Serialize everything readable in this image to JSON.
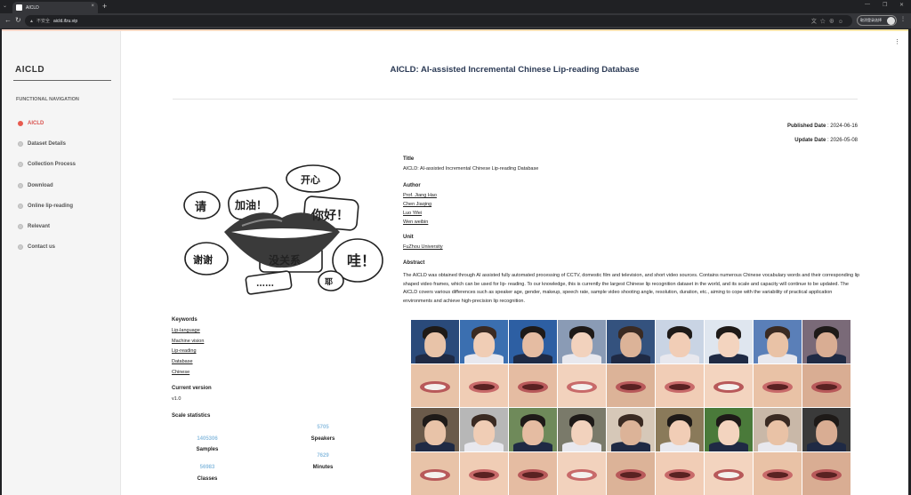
{
  "browser": {
    "tab_title": "AICLD",
    "tab_close": "×",
    "new_tab": "+",
    "insecure_label": "不安全",
    "url": "aicld.ifzu.vip",
    "profile_label": "取消登录选择",
    "window_controls": [
      "—",
      "❐",
      "✕"
    ]
  },
  "sidebar": {
    "brand": "AICLD",
    "heading": "FUNCTIONAL NAVIGATION",
    "items": [
      {
        "label": "AICLD",
        "active": true
      },
      {
        "label": "Dataset Details"
      },
      {
        "label": "Collection Process"
      },
      {
        "label": "Download"
      },
      {
        "label": "Online lip-reading"
      },
      {
        "label": "Relevant"
      },
      {
        "label": "Contact us"
      }
    ]
  },
  "header": {
    "title": "AICLD: AI-assisted Incremental Chinese Lip-reading Database"
  },
  "meta": {
    "published_label": "Published Date",
    "published_value": " : 2024-06-16",
    "updated_label": "Update Date",
    "updated_value": " : 2026-05-08"
  },
  "details": {
    "title_heading": "Title",
    "title_value": "AICLD: AI-assisted Incremental Chinese Lip-reading Database",
    "author_heading": "Author",
    "authors": [
      "Prof. Jiang Hao",
      "Chen Jiaqing",
      "Luo Yifei",
      "Wen weibin"
    ],
    "unit_heading": "Unit",
    "unit_value": "FuZhou University",
    "abstract_heading": "Abstract",
    "abstract_text": "The AICLD was obtained through AI assisted fully automated processing of CCTV, domestic film and television, and short video sources. Contains numerous Chinese vocabulary words and their corresponding lip shaped video frames, which can be used for lip- reading. To our knowledge, this is currently the largest Chinese lip recognition dataset in the world, and its scale and capacity will continue to be updated. The AICLD covers various differences such as speaker age, gender, makeup, speech rate, sample video shooting angle, resolution, duration, etc., aiming to cope with the variability of practical application environments and achieve high-precision lip recognition."
  },
  "hero": {
    "bubbles": [
      "请",
      "加油！",
      "开心",
      "你好！",
      "谢谢",
      "没关系",
      "哇！",
      "……",
      "耶"
    ]
  },
  "keywords": {
    "heading": "Keywords",
    "items": [
      "Lip-language",
      "Machine vision",
      "Lip-reading",
      "Database",
      "Chinese"
    ]
  },
  "version": {
    "heading": "Current version",
    "value": "v1.0"
  },
  "stats": {
    "heading": "Scale statistics",
    "samples_value": "1405306",
    "samples_label": "Samples",
    "speakers_value": "5705",
    "speakers_label": "Speakers",
    "classes_value": "56983",
    "classes_label": "Classes",
    "minutes_value": "7629",
    "minutes_label": "Minutes"
  },
  "colors": {
    "accent_red": "#e85b4f",
    "title_navy": "#2b3a55",
    "stat_blue": "#8fbfe0"
  }
}
